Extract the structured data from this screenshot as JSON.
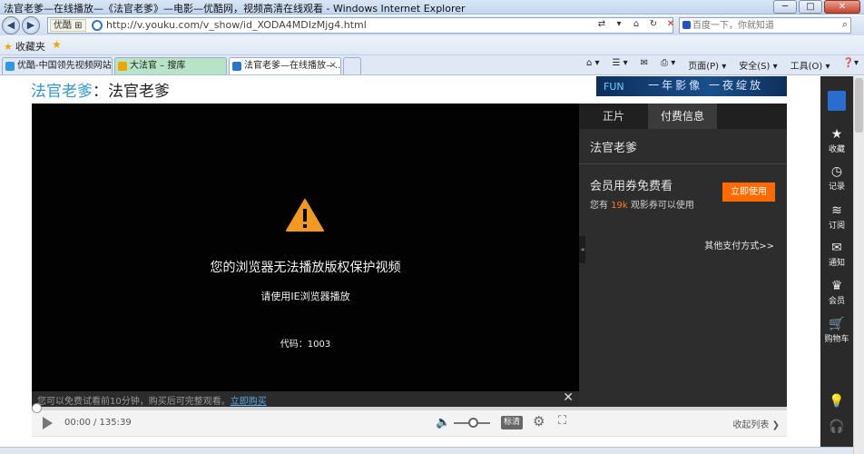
{
  "window": {
    "title": "法官老爹—在线播放—《法官老爹》—电影—优酷网，视频高清在线观看 - Windows Internet Explorer",
    "minimize": "─",
    "maximize": "□",
    "close": "✕"
  },
  "address": {
    "site_badge": "优酷 ⊞",
    "url": "http://v.youku.com/v_show/id_XODA4MDIzMjg4.html",
    "search_placeholder": "百度一下，你就知道"
  },
  "favorites": {
    "label": "收藏夹"
  },
  "tabs": [
    {
      "label": "优酷-中国领先视频网站,提...",
      "icon_color": "#3399dd"
    },
    {
      "label": "大法官 – 搜库",
      "icon_color": "#e8a800"
    },
    {
      "label": "法官老爹—在线播放—...",
      "icon_color": "#2a74c9"
    }
  ],
  "command_bar": {
    "page": "页面(P) ▾",
    "safety": "安全(S) ▾",
    "tools": "工具(O) ▾",
    "help": "❓▾"
  },
  "page": {
    "crumb_link": "法官老爹",
    "crumb_sep": "：",
    "crumb_title": "法官老爹",
    "banner_text": "一年影像 一夜绽放",
    "banner_logo": "FUN"
  },
  "player": {
    "error_title": "您的浏览器无法播放版权保护视频",
    "error_hint": "请使用IE浏览器播放",
    "error_code": "代码：1003",
    "trial_text": "您可以免费试看前10分钟，购买后可完整观看。",
    "trial_link": "立即购买",
    "trial_close": "✕",
    "time": "00:00 / 135:39",
    "quality": "标清",
    "collapse": "收起列表 ❯",
    "progress": 0,
    "volume": 0.5
  },
  "side_panel": {
    "tabs": [
      "正片",
      "付费信息"
    ],
    "active_tab": 1,
    "movie_title": "法官老爹",
    "vip_title": "会员用券免费看",
    "coupon_prefix": "您有",
    "coupon_count": "19k",
    "coupon_suffix": "观影券可以使用",
    "use_button": "立即使用",
    "other_pay": "其他支付方式>>"
  },
  "right_bar": {
    "items": [
      {
        "icon": "★",
        "label": "收藏"
      },
      {
        "icon": "◷",
        "label": "记录"
      },
      {
        "icon": "≋",
        "label": "订阅"
      },
      {
        "icon": "✉",
        "label": "通知"
      },
      {
        "icon": "♛",
        "label": "会员"
      },
      {
        "icon": "🛒",
        "label": "购物车"
      }
    ]
  },
  "colors": {
    "accent_blue": "#3296d6",
    "accent_orange": "#ff6a00",
    "warning_orange": "#f29a1f"
  }
}
